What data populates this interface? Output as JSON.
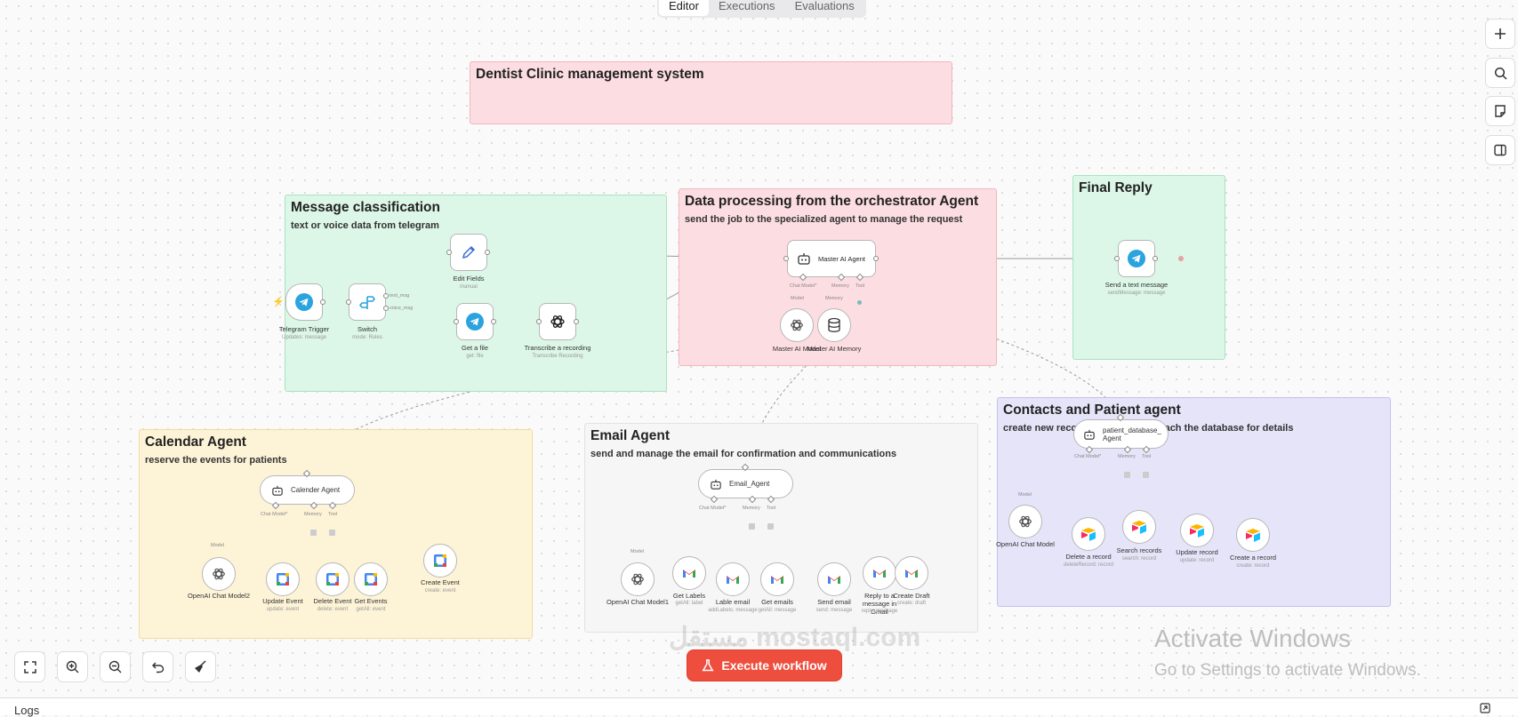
{
  "tabs": [
    "Editor",
    "Executions",
    "Evaluations"
  ],
  "stickies": {
    "title": {
      "heading": "Dentist Clinic management system"
    },
    "classification": {
      "heading": "Message classification",
      "sub": "text or voice data from telegram"
    },
    "processing": {
      "heading": "Data processing from the orchestrator Agent",
      "sub": "send the job to the specialized agent to manage the request"
    },
    "final": {
      "heading": "Final Reply"
    },
    "calendar": {
      "heading": "Calendar Agent",
      "sub": "reserve the events for patients"
    },
    "email": {
      "heading": "Email Agent",
      "sub": "send and manage the email for confirmation and communications"
    },
    "contacts": {
      "heading": "Contacts and Patient agent",
      "sub": "create new records update and serach the database for details"
    }
  },
  "nodes": {
    "telegram_trigger": {
      "label": "Telegram Trigger",
      "sub": "Updates: message"
    },
    "switch": {
      "label": "Switch",
      "sub": "mode: Rules",
      "out1": "text_msg",
      "out2": "voice_msg"
    },
    "edit_fields": {
      "label": "Edit Fields",
      "sub": "manual"
    },
    "get_file": {
      "label": "Get a file",
      "sub": "get: file"
    },
    "transcribe": {
      "label": "Transcribe a recording",
      "sub": "Transcribe Recording"
    },
    "master_agent": {
      "label": "Master AI Agent",
      "p1": "Chat Model*",
      "p2": "Memory",
      "p3": "Tool"
    },
    "master_model": {
      "label": "Master AI Model",
      "p": "Model"
    },
    "master_memory": {
      "label": "Master AI Memory",
      "p": "Memory"
    },
    "send_text": {
      "label": "Send a text message",
      "sub": "sendMessage: message"
    },
    "calendar_agent": {
      "label": "Calender Agent",
      "p1": "Chat Model*",
      "p2": "Memory",
      "p3": "Tool"
    },
    "openai_model2": {
      "label": "OpenAI Chat Model2",
      "p": "Model"
    },
    "update_event": {
      "label": "Update Event",
      "sub": "update: event"
    },
    "delete_event": {
      "label": "Delete Event",
      "sub": "delete: event"
    },
    "get_events": {
      "label": "Get Events",
      "sub": "getAll: event"
    },
    "create_event": {
      "label": "Create Event",
      "sub": "create: event"
    },
    "email_agent": {
      "label": "Email_Agent",
      "p1": "Chat Model*",
      "p2": "Memory",
      "p3": "Tool"
    },
    "openai_model1": {
      "label": "OpenAI Chat Model1",
      "p": "Model"
    },
    "get_labels": {
      "label": "Get Labels",
      "sub": "getAll: label"
    },
    "lable_email": {
      "label": "Lable email",
      "sub": "addLabels: message"
    },
    "get_emails": {
      "label": "Get emails",
      "sub": "getAll: message"
    },
    "send_email": {
      "label": "Send email",
      "sub": "send: message"
    },
    "reply_gmail": {
      "label": "Reply to a message in Gmail",
      "sub": "reply: message"
    },
    "create_draft": {
      "label": "Create Draft",
      "sub": "create: draft"
    },
    "patient_agent": {
      "label": "patient_database_Agent",
      "p1": "Chat Model*",
      "p2": "Memory",
      "p3": "Tool"
    },
    "openai_model": {
      "label": "OpenAI Chat Model",
      "p": "Model"
    },
    "delete_record": {
      "label": "Delete a record",
      "sub": "deleteRecord: record"
    },
    "search_records": {
      "label": "Search records",
      "sub": "search: record"
    },
    "update_record": {
      "label": "Update record",
      "sub": "update: record"
    },
    "create_record": {
      "label": "Create a record",
      "sub": "create: record"
    }
  },
  "execute_label": "Execute workflow",
  "watermark": "مستقل mostaql.com",
  "activate": {
    "title": "Activate Windows",
    "sub": "Go to Settings to activate Windows."
  },
  "logs_label": "Logs",
  "colors": {
    "accent": "#ee4e3e",
    "telegram": "#2aa3df"
  }
}
